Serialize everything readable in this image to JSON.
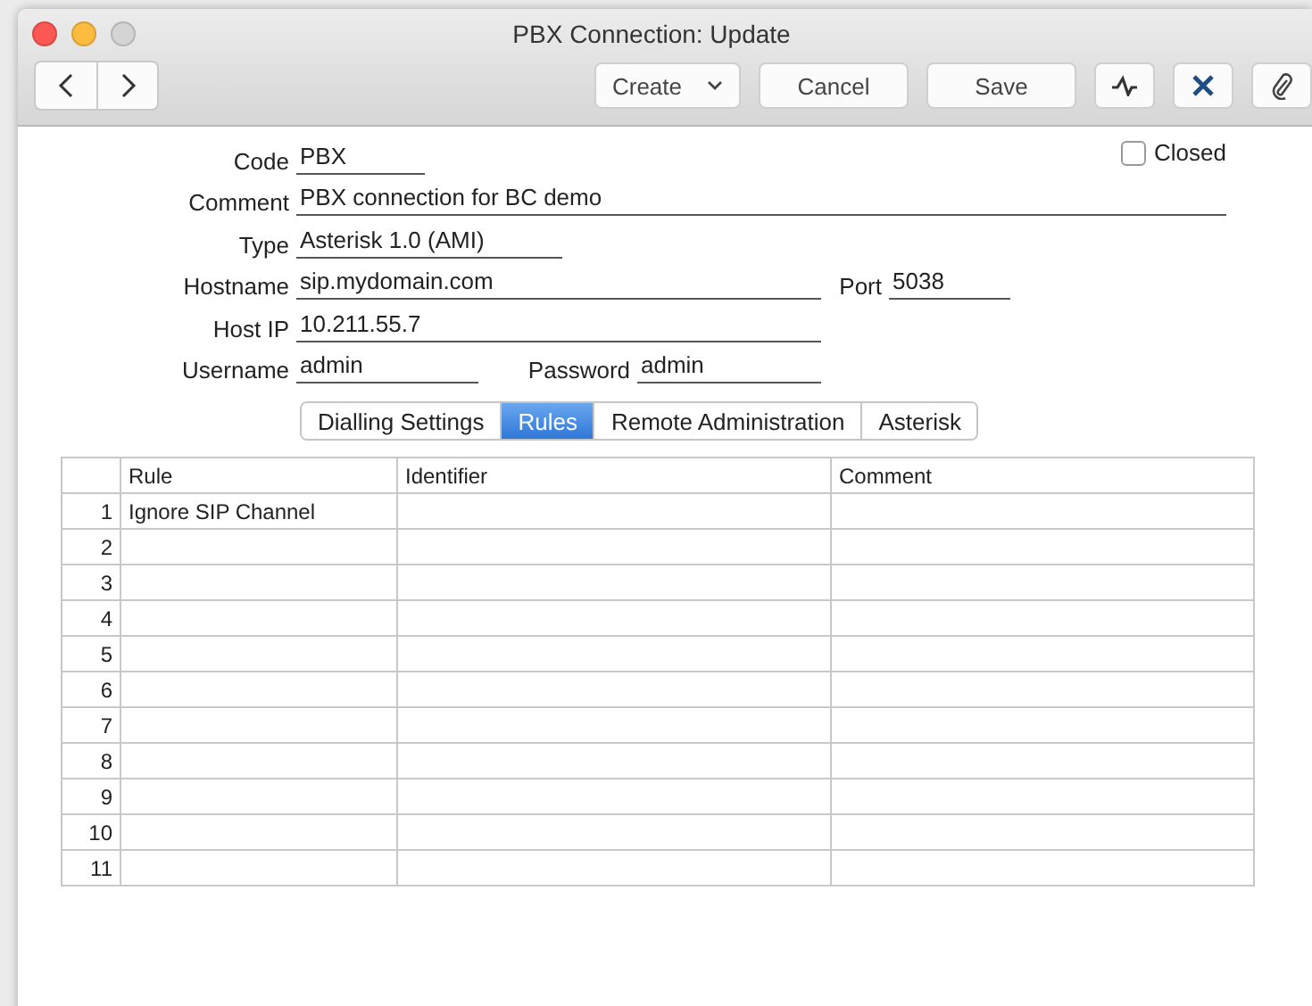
{
  "window": {
    "title": "PBX Connection: Update"
  },
  "toolbar": {
    "create": "Create",
    "cancel": "Cancel",
    "save": "Save"
  },
  "form": {
    "code": {
      "label": "Code",
      "value": "PBX"
    },
    "closed": {
      "label": "Closed",
      "checked": false
    },
    "comment": {
      "label": "Comment",
      "value": "PBX connection for BC demo"
    },
    "type": {
      "label": "Type",
      "value": "Asterisk 1.0 (AMI)"
    },
    "hostname": {
      "label": "Hostname",
      "value": "sip.mydomain.com"
    },
    "port": {
      "label": "Port",
      "value": "5038"
    },
    "host_ip": {
      "label": "Host IP",
      "value": "10.211.55.7"
    },
    "username": {
      "label": "Username",
      "value": "admin"
    },
    "password": {
      "label": "Password",
      "value": "admin"
    }
  },
  "tabs": [
    {
      "label": "Dialling Settings",
      "selected": false
    },
    {
      "label": "Rules",
      "selected": true
    },
    {
      "label": "Remote Administration",
      "selected": false
    },
    {
      "label": "Asterisk",
      "selected": false
    }
  ],
  "table": {
    "columns": [
      "Rule",
      "Identifier",
      "Comment"
    ],
    "rows": [
      {
        "number": "1",
        "rule": "Ignore SIP Channel"
      },
      {
        "number": "2"
      },
      {
        "number": "3"
      },
      {
        "number": "4"
      },
      {
        "number": "5"
      },
      {
        "number": "6"
      },
      {
        "number": "7"
      },
      {
        "number": "8"
      },
      {
        "number": "9"
      },
      {
        "number": "10"
      },
      {
        "number": "11"
      }
    ]
  }
}
